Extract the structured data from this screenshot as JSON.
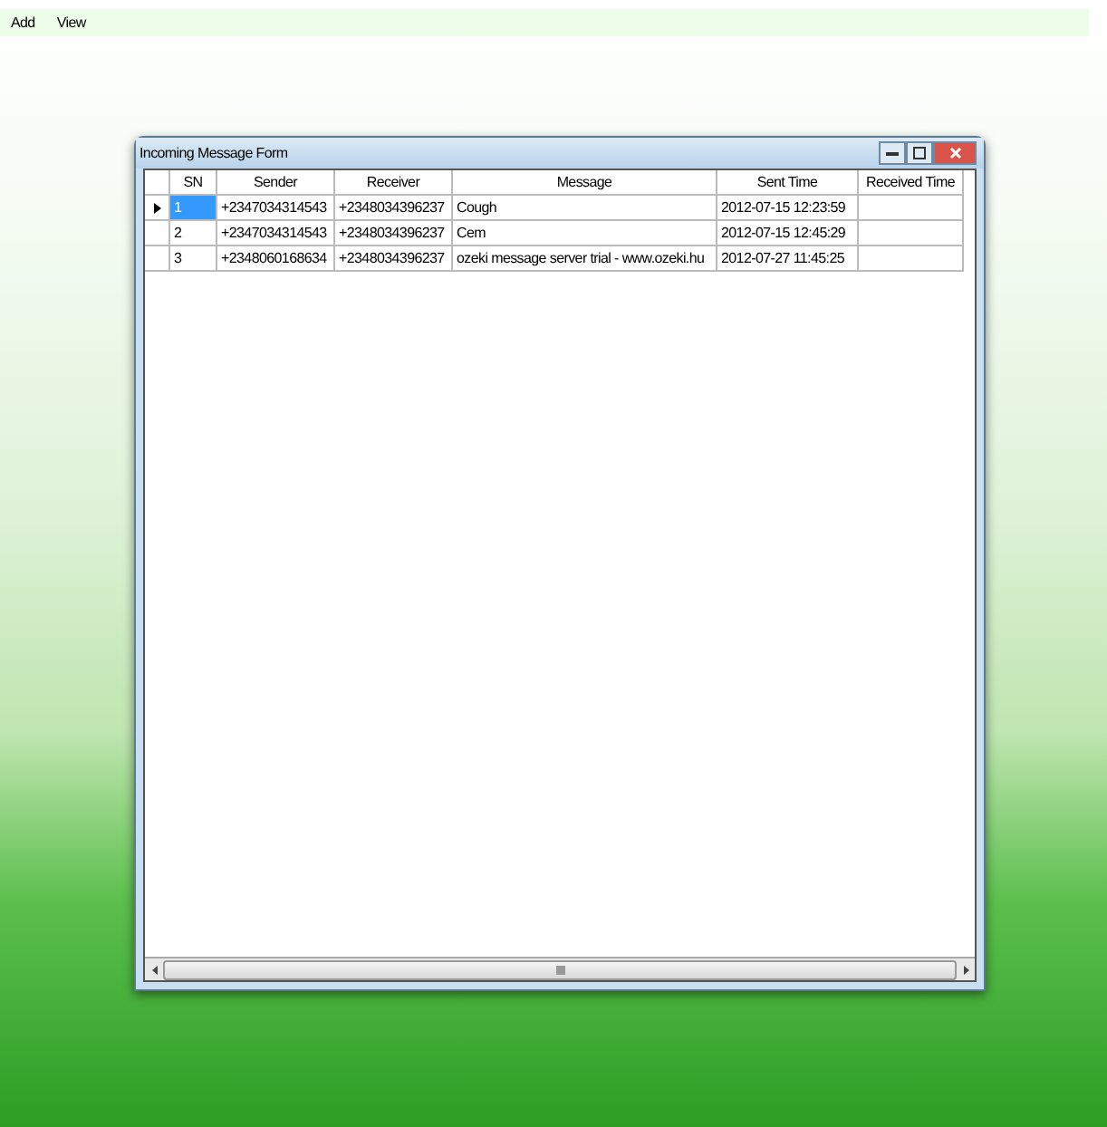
{
  "menu": [
    "Add",
    "View"
  ],
  "window": {
    "title": "Incoming Message Form"
  },
  "table": {
    "columns": [
      "SN",
      "Sender",
      "Receiver",
      "Message",
      "Sent Time",
      "Received Time"
    ],
    "rows": [
      {
        "selected": true,
        "cells": [
          "1",
          "+2347034314543",
          "+2348034396237",
          "Cough",
          "2012-07-15 12:23:59",
          ""
        ]
      },
      {
        "selected": false,
        "cells": [
          "2",
          "+2347034314543",
          "+2348034396237",
          "Cem",
          "2012-07-15 12:45:29",
          ""
        ]
      },
      {
        "selected": false,
        "cells": [
          "3",
          "+2348060168634",
          "+2348034396237",
          "ozeki message server trial - www.ozeki.hu",
          "2012-07-27 11:45:25",
          ""
        ]
      }
    ]
  }
}
